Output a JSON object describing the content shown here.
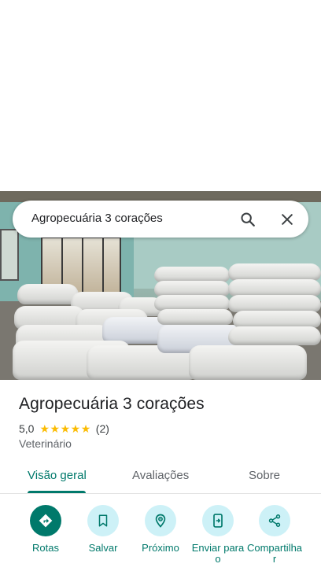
{
  "search": {
    "query": "Agropecuária 3 corações",
    "search_icon": "search-icon",
    "close_icon": "close-icon"
  },
  "place": {
    "name": "Agropecuária 3 corações",
    "rating": "5,0",
    "stars": 5,
    "review_count": "(2)",
    "category": "Veterinário"
  },
  "tabs": [
    {
      "label": "Visão geral",
      "active": true
    },
    {
      "label": "Avaliações",
      "active": false
    },
    {
      "label": "Sobre",
      "active": false
    }
  ],
  "actions": [
    {
      "label": "Rotas",
      "icon": "directions-icon"
    },
    {
      "label": "Salvar",
      "icon": "bookmark-icon"
    },
    {
      "label": "Próximo",
      "icon": "nearby-icon"
    },
    {
      "label": "Enviar para o",
      "icon": "send-to-phone-icon"
    },
    {
      "label": "Compartilhar",
      "icon": "share-icon"
    }
  ],
  "colors": {
    "accent": "#00796b",
    "action_bg": "#cdf1f7",
    "star": "#fbbc04"
  }
}
